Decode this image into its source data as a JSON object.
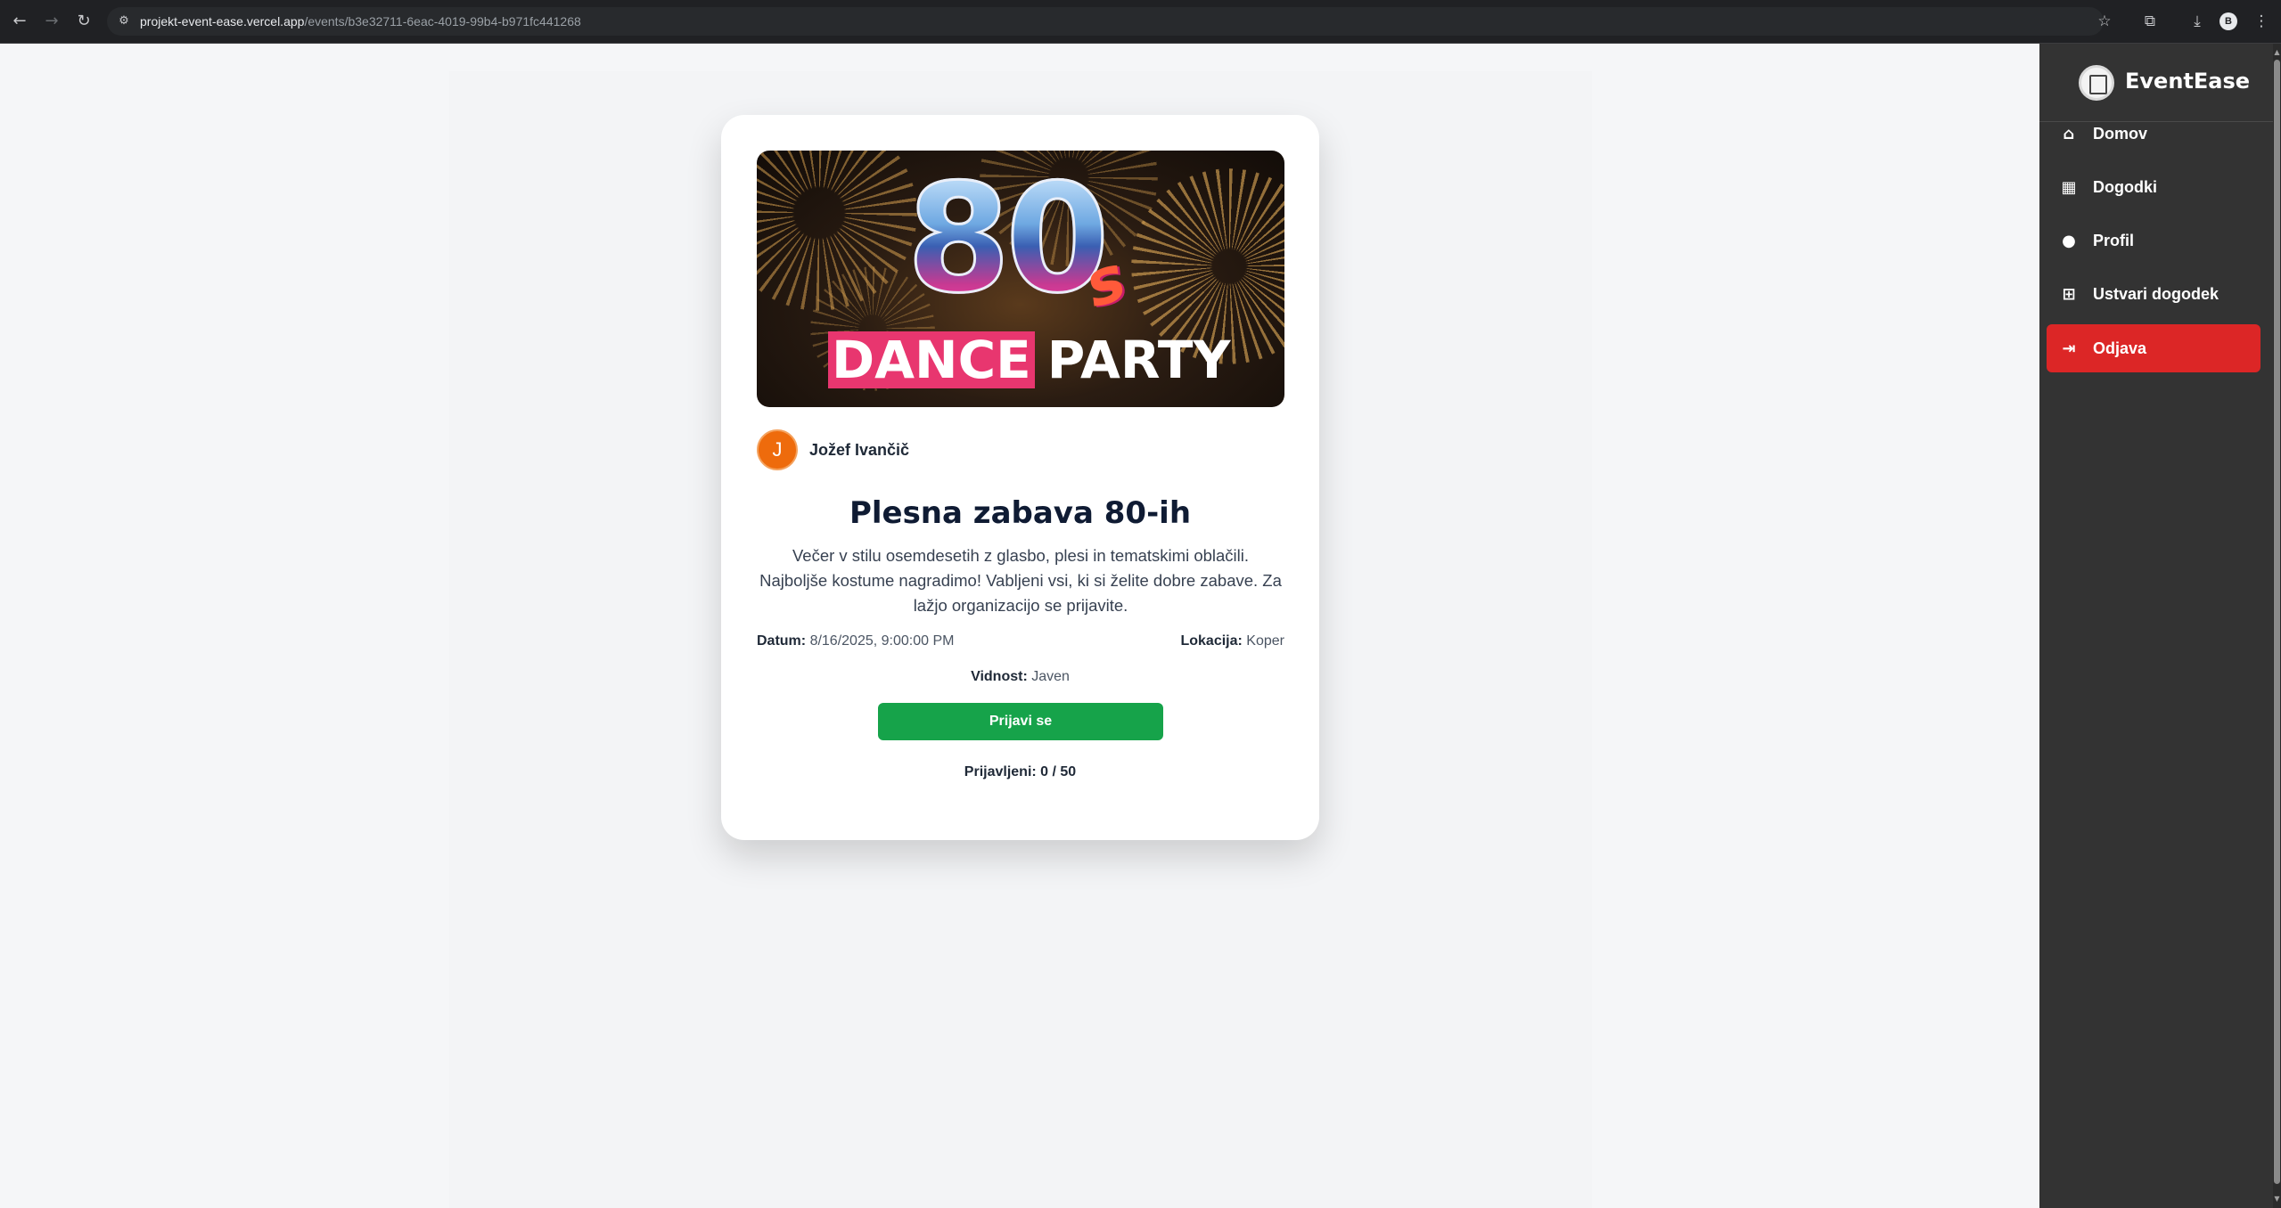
{
  "browser": {
    "url_domain": "projekt-event-ease.vercel.app",
    "url_path": "/events/b3e32711-6eac-4019-99b4-b971fc441268",
    "profile_initial": "B"
  },
  "event": {
    "banner": {
      "numeral": "80",
      "suffix": "s",
      "word1": "DANCE",
      "word2": "PARTY"
    },
    "organizer_initial": "J",
    "organizer_name": "Jožef Ivančič",
    "title": "Plesna zabava 80-ih",
    "description": "Večer v stilu osemdesetih z glasbo, plesi in tematskimi oblačili. Najboljše kostume nagradimo! Vabljeni vsi, ki si želite dobre zabave. Za lažjo organizacijo se prijavite.",
    "date_label": "Datum:",
    "date_value": "8/16/2025, 9:00:00 PM",
    "location_label": "Lokacija:",
    "location_value": "Koper",
    "visibility_label": "Vidnost:",
    "visibility_value": "Javen",
    "join_label": "Prijavi se",
    "registered_label": "Prijavljeni:",
    "registered_value": "0 / 50"
  },
  "sidebar": {
    "brand": "EventEase",
    "items": [
      {
        "label": "Domov",
        "icon": "home-icon"
      },
      {
        "label": "Dogodki",
        "icon": "calendar-icon"
      },
      {
        "label": "Profil",
        "icon": "user-icon"
      },
      {
        "label": "Ustvari dogodek",
        "icon": "plus-square-icon"
      },
      {
        "label": "Odjava",
        "icon": "sign-out-icon"
      }
    ]
  },
  "colors": {
    "sidebar_bg": "#333333",
    "logout_bg": "#dc2626",
    "join_button": "#16a34a",
    "avatar": "#ee6b0c"
  }
}
